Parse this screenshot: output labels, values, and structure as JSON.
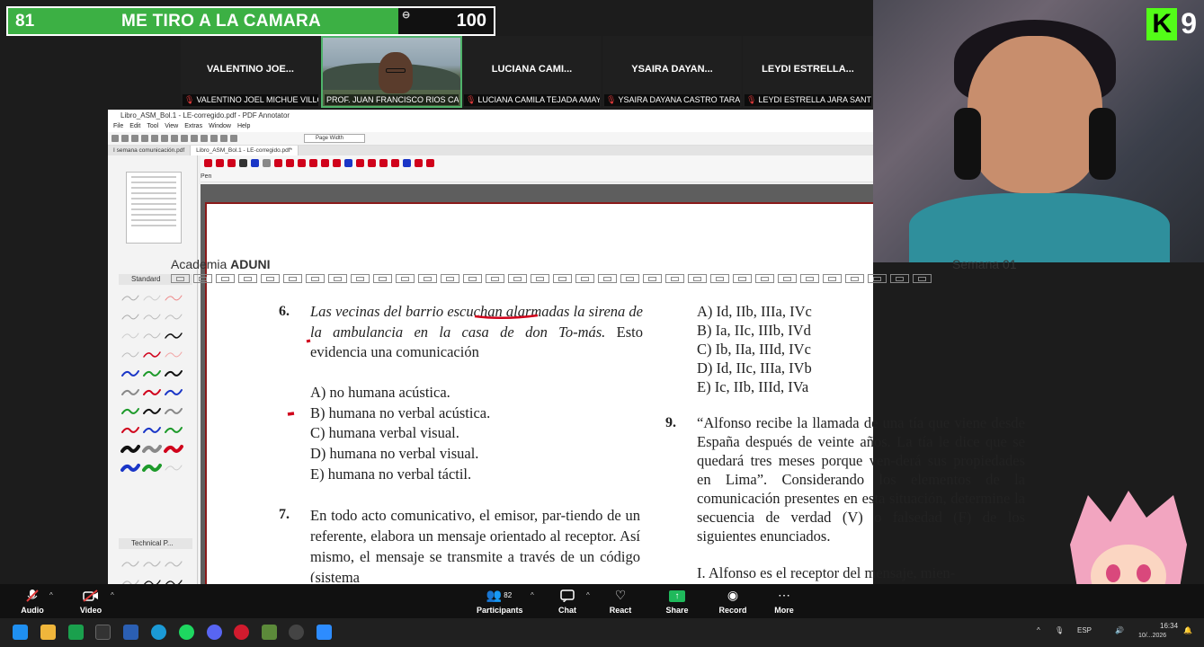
{
  "scorebar": {
    "left_count": "81",
    "title": "ME TIRO A LA CAMARA",
    "right_count": "100",
    "menu_icon": "more-dots-icon"
  },
  "participants": [
    {
      "tile_name": "VALENTINO JOE...",
      "label": "VALENTINO JOEL MICHUE VILLO..."
    },
    {
      "tile_name": "",
      "label": "PROF. JUAN FRANCISCO RIOS CAC..."
    },
    {
      "tile_name": "LUCIANA CAMI...",
      "label": "LUCIANA CAMILA TEJADA AMAYA"
    },
    {
      "tile_name": "YSAIRA DAYAN...",
      "label": "YSAIRA DAYANA CASTRO TARAZ..."
    },
    {
      "tile_name": "LEYDI ESTRELLA...",
      "label": "LEYDI ESTRELLA JARA SANTIAGO"
    }
  ],
  "stream": {
    "kick_letter": "K",
    "number": "9"
  },
  "pdf": {
    "title": "Libro_ASM_Bol.1 - LE-corregido.pdf - PDF Annotator",
    "menu": [
      "File",
      "Edit",
      "Tool",
      "View",
      "Extras",
      "Window",
      "Help"
    ],
    "zoom_select": "Page Width",
    "tabs": [
      "I semana comunicación.pdf",
      "Libro_ASM_Bol.1 - LE-corregido.pdf*"
    ],
    "pens_group": "Standard",
    "tech_group": "Technical P...",
    "pen_label": "Pen"
  },
  "document": {
    "header_left_a": "Academia ",
    "header_left_b": "ADUNI",
    "header_right": "Semana 01",
    "q6": {
      "num": "6.",
      "text_italic_1": "Las vecinas del barrio escuchan alarmadas la sirena de la ambulancia en la casa de don To-más.",
      "text_plain": " Esto evidencia una comunicación",
      "options": [
        "A) no humana acústica.",
        "B) humana no verbal acústica.",
        "C) humana verbal visual.",
        "D) humana no verbal visual.",
        "E) humana no verbal táctil."
      ]
    },
    "q7": {
      "num": "7.",
      "text": "En todo acto comunicativo, el emisor, par-tiendo de un referente, elabora un mensaje orientado al receptor. Así mismo, el mensaje se transmite a través de un código (sistema"
    },
    "right_options": [
      "A) Id, IIb, IIIa, IVc",
      "B) Ia, IIc, IIIb, IVd",
      "C) Ib, IIa, IIId, IVc",
      "D) Id, IIc, IIIa, IVb",
      "E) Ic, IIb, IIId, IVa"
    ],
    "q9": {
      "num": "9.",
      "text": "“Alfonso recibe la llamada de una tía que viene desde España después de veinte años. La tía le dice que se quedará tres meses porque ven-derá sus propiedades en Lima”. Considerando los elementos de la comunicación presentes en esta situación, determine la secuencia de verdad (V) o falsedad (F) de los siguientes enunciados.",
      "item1": "I.   Alfonso es el receptor del mensaje, mien-"
    }
  },
  "zoom": {
    "audio": "Audio",
    "video": "Video",
    "participants": "Participants",
    "participants_count": "82",
    "chat": "Chat",
    "react": "React",
    "share": "Share",
    "record": "Record",
    "more": "More"
  },
  "taskbar": {
    "lang": "ESP",
    "time": "16:34",
    "date": "10/...2026"
  },
  "colors": {
    "score_green": "#3cb044",
    "kick_green": "#53fc18",
    "annotation_red": "#d0021b",
    "page_border": "#8a1a1a"
  }
}
